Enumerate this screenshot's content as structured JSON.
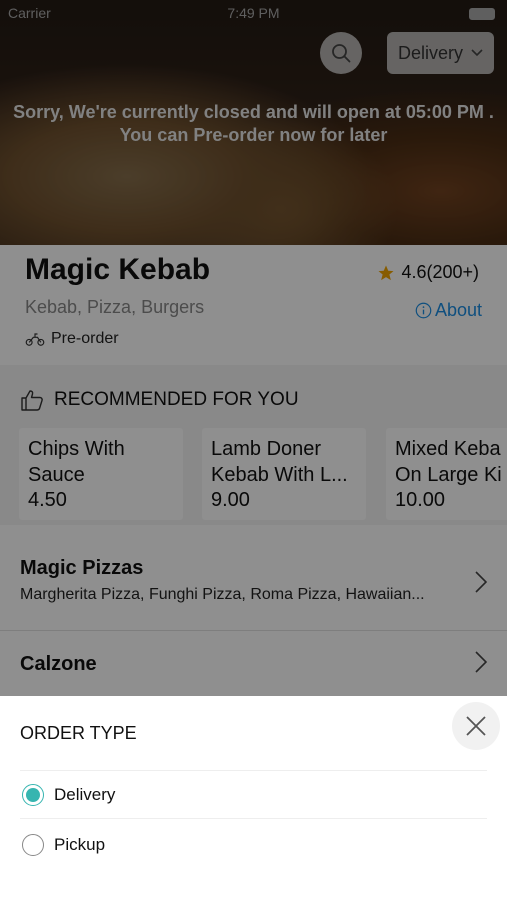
{
  "status_bar": {
    "carrier": "Carrier",
    "time": "7:49 PM"
  },
  "header": {
    "order_type_button": "Delivery",
    "closed_message_line1": "Sorry, We're currently closed and will open at 05:00 PM .",
    "closed_message_line2": "You can Pre-order now for later"
  },
  "restaurant": {
    "name": "Magic Kebab",
    "rating": "4.6(200+)",
    "cuisines": "Kebab, Pizza, Burgers",
    "about_label": "About",
    "preorder_label": "Pre-order"
  },
  "recommended": {
    "title": "RECOMMENDED FOR YOU",
    "items": [
      {
        "name": "Chips With\nSauce",
        "price": "4.50"
      },
      {
        "name": "Lamb Doner\nKebab With L...",
        "price": "9.00"
      },
      {
        "name": "Mixed Keba\nOn Large Ki",
        "price": "10.00"
      }
    ]
  },
  "categories": [
    {
      "title": "Magic Pizzas",
      "subtitle": "Margherita Pizza, Funghi Pizza, Roma Pizza, Hawaiian..."
    },
    {
      "title": "Calzone",
      "subtitle": ""
    }
  ],
  "order_type_sheet": {
    "title": "ORDER TYPE",
    "options": [
      {
        "label": "Delivery",
        "selected": true
      },
      {
        "label": "Pickup",
        "selected": false
      }
    ]
  },
  "colors": {
    "accent": "#36b5b0",
    "link": "#1c8ee3",
    "star": "#f0a500"
  }
}
